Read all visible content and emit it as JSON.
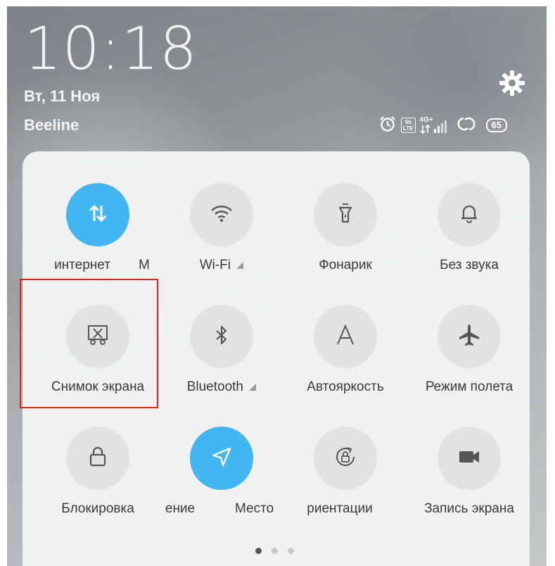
{
  "status_bar": {
    "time": "10:18",
    "date": "Вт, 11 Ноя",
    "operator": "Beeline",
    "network_type": "4G+",
    "volte_top": "Vo",
    "volte_bottom": "LTE",
    "battery": "65",
    "icons": [
      "alarm-icon",
      "volte-icon",
      "signal-icon",
      "hotspot-icon",
      "battery-icon"
    ]
  },
  "settings_icon": "gear-icon",
  "quick_settings": {
    "rows": [
      [
        {
          "id": "internet",
          "label": "интернет",
          "icon": "data-transfer-icon",
          "active": true
        },
        {
          "id": "wifi",
          "label": "Wi-Fi",
          "icon": "wifi-icon",
          "active": false
        },
        {
          "id": "flashlight",
          "label": "Фонарик",
          "icon": "flashlight-icon",
          "active": false
        },
        {
          "id": "silent",
          "label": "Без звука",
          "icon": "bell-icon",
          "active": false
        }
      ],
      [
        {
          "id": "screenshot",
          "label": "Снимок экрана",
          "icon": "screenshot-icon",
          "active": false
        },
        {
          "id": "bluetooth",
          "label": "Bluetooth",
          "icon": "bluetooth-icon",
          "active": false
        },
        {
          "id": "autobrightness",
          "label": "Автояркость",
          "icon": "auto-brightness-icon",
          "active": false
        },
        {
          "id": "airplane",
          "label": "Режим полета",
          "icon": "airplane-icon",
          "active": false
        }
      ],
      [
        {
          "id": "lock",
          "label": "Блокировка",
          "icon": "lock-icon",
          "active": false
        },
        {
          "id": "location",
          "label": "ение",
          "icon": "location-icon",
          "active": true
        },
        {
          "id": "rotation",
          "label": "риентации",
          "icon": "rotation-lock-icon",
          "active": false
        },
        {
          "id": "screenrecord",
          "label": "Запись экрана",
          "icon": "video-camera-icon",
          "active": false
        }
      ]
    ],
    "overflow_fragments": {
      "row1": "М",
      "row3": "Место"
    },
    "pages": 3,
    "current_page": 1
  },
  "highlight": {
    "target": "screenshot",
    "color": "#e2231a"
  },
  "colors": {
    "accent": "#42b6f0",
    "tile": "#e2e2e2",
    "panel": "#f3f3f3"
  }
}
